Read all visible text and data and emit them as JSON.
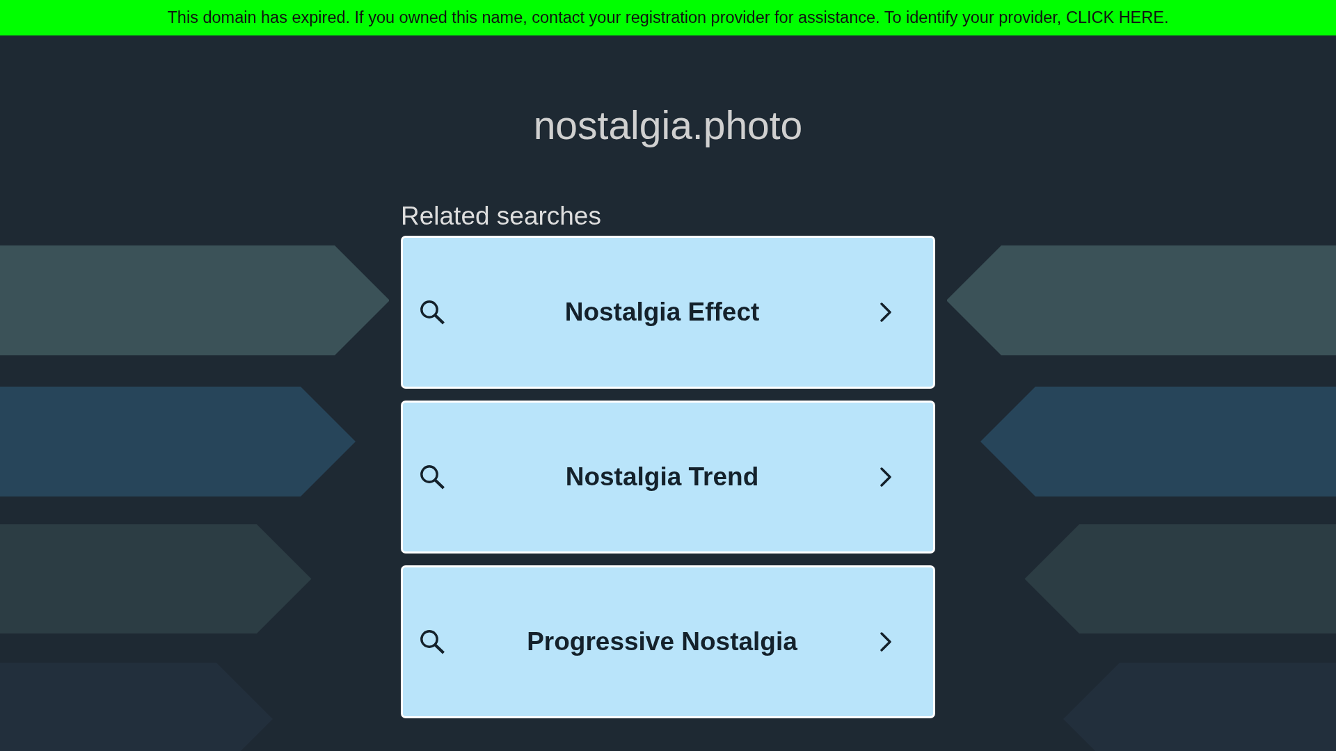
{
  "banner": {
    "text": "This domain has expired. If you owned this name, contact your registration provider for assistance. To identify your provider, CLICK HERE."
  },
  "site_title": "nostalgia.photo",
  "related_searches": {
    "heading": "Related searches",
    "items": [
      {
        "label": "Nostalgia Effect"
      },
      {
        "label": "Nostalgia Trend"
      },
      {
        "label": "Progressive Nostalgia"
      }
    ]
  }
}
